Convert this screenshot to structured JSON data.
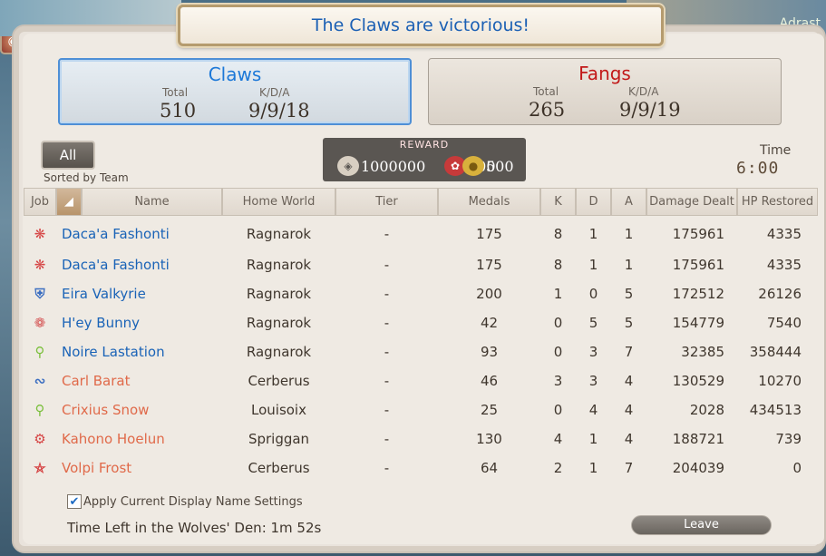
{
  "banner": {
    "text": "The Claws are victorious!"
  },
  "background": {
    "player_name": "Adrast"
  },
  "teams": {
    "claws": {
      "name": "Claws",
      "total_label": "Total",
      "kda_label": "K/D/A",
      "total": "510",
      "kda": "9/9/18"
    },
    "fangs": {
      "name": "Fangs",
      "total_label": "Total",
      "kda_label": "K/D/A",
      "total": "265",
      "kda": "9/9/19"
    }
  },
  "filters": {
    "all_label": "All",
    "sorted_label": "Sorted by Team"
  },
  "reward": {
    "label": "REWARD",
    "items": [
      {
        "icon": "exp-icon",
        "value": "1000000"
      },
      {
        "icon": "wolf-mark-icon",
        "value": "500"
      },
      {
        "icon": "gil-icon",
        "value": "500"
      }
    ]
  },
  "time": {
    "label": "Time",
    "value": "6:00"
  },
  "table": {
    "headers": [
      "Job",
      "",
      "Name",
      "Home World",
      "Tier",
      "Medals",
      "K",
      "D",
      "A",
      "Damage Dealt",
      "HP Restored"
    ],
    "rows": [
      {
        "job": "red-mage-icon",
        "name": "Daca'a Fashonti",
        "team": "claws",
        "world": "Ragnarok",
        "tier": "-",
        "medals": "175",
        "k": "8",
        "d": "1",
        "a": "1",
        "dmg": "175961",
        "heal": "4335"
      },
      {
        "job": "red-mage-icon",
        "name": "Daca'a Fashonti",
        "team": "claws",
        "world": "Ragnarok",
        "tier": "-",
        "medals": "175",
        "k": "8",
        "d": "1",
        "a": "1",
        "dmg": "175961",
        "heal": "4335"
      },
      {
        "job": "paladin-icon",
        "name": "Eira Valkyrie",
        "team": "claws",
        "world": "Ragnarok",
        "tier": "-",
        "medals": "200",
        "k": "1",
        "d": "0",
        "a": "5",
        "dmg": "172512",
        "heal": "26126"
      },
      {
        "job": "dancer-icon",
        "name": "H'ey Bunny",
        "team": "claws",
        "world": "Ragnarok",
        "tier": "-",
        "medals": "42",
        "k": "0",
        "d": "5",
        "a": "5",
        "dmg": "154779",
        "heal": "7540"
      },
      {
        "job": "white-mage-icon",
        "name": "Noire Lastation",
        "team": "claws",
        "world": "Ragnarok",
        "tier": "-",
        "medals": "93",
        "k": "0",
        "d": "3",
        "a": "7",
        "dmg": "32385",
        "heal": "358444"
      },
      {
        "job": "dragoon-icon",
        "name": "Carl Barat",
        "team": "fangs",
        "world": "Cerberus",
        "tier": "-",
        "medals": "46",
        "k": "3",
        "d": "3",
        "a": "4",
        "dmg": "130529",
        "heal": "10270"
      },
      {
        "job": "white-mage-icon",
        "name": "Crixius Snow",
        "team": "fangs",
        "world": "Louisoix",
        "tier": "-",
        "medals": "25",
        "k": "0",
        "d": "4",
        "a": "4",
        "dmg": "2028",
        "heal": "434513"
      },
      {
        "job": "ninja-icon",
        "name": "Kahono Hoelun",
        "team": "fangs",
        "world": "Spriggan",
        "tier": "-",
        "medals": "130",
        "k": "4",
        "d": "1",
        "a": "4",
        "dmg": "188721",
        "heal": "739"
      },
      {
        "job": "warrior-icon",
        "name": "Volpi Frost",
        "team": "fangs",
        "world": "Cerberus",
        "tier": "-",
        "medals": "64",
        "k": "2",
        "d": "1",
        "a": "7",
        "dmg": "204039",
        "heal": "0"
      }
    ]
  },
  "footer": {
    "checkbox_label": "Apply Current Display Name Settings",
    "checkbox_checked": true,
    "time_left": "Time Left in the Wolves' Den: 1m 52s",
    "leave_label": "Leave"
  },
  "colors": {
    "claws": "#1a63b7",
    "fangs": "#e06a4a",
    "banner_text": "#1a5fb4"
  }
}
